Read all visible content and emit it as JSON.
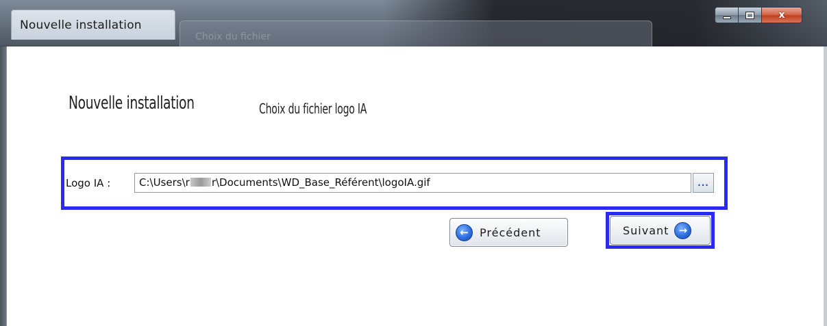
{
  "window": {
    "title": "Nouvelle installation",
    "background_tab_hint": "Choix du fichier",
    "close_glyph": "x",
    "colors": {
      "highlight": "#2b2bf0",
      "arrow_icon": "#2c6fe0",
      "browse_dots": "#1e4fd1"
    }
  },
  "wizard": {
    "heading": "Nouvelle installation",
    "step_title": "Choix du fichier logo IA"
  },
  "logo_field": {
    "label": "Logo IA :",
    "value_prefix": "C:\\Users\\r",
    "value_suffix": "r\\Documents\\WD_Base_Référent\\logoIA.gif",
    "browse_label": "..."
  },
  "buttons": {
    "previous": {
      "label": "Précédent",
      "icon": "arrow-left-icon",
      "arrow_glyph": "←"
    },
    "next": {
      "label": "Suivant",
      "icon": "arrow-right-icon",
      "arrow_glyph": "→"
    }
  }
}
